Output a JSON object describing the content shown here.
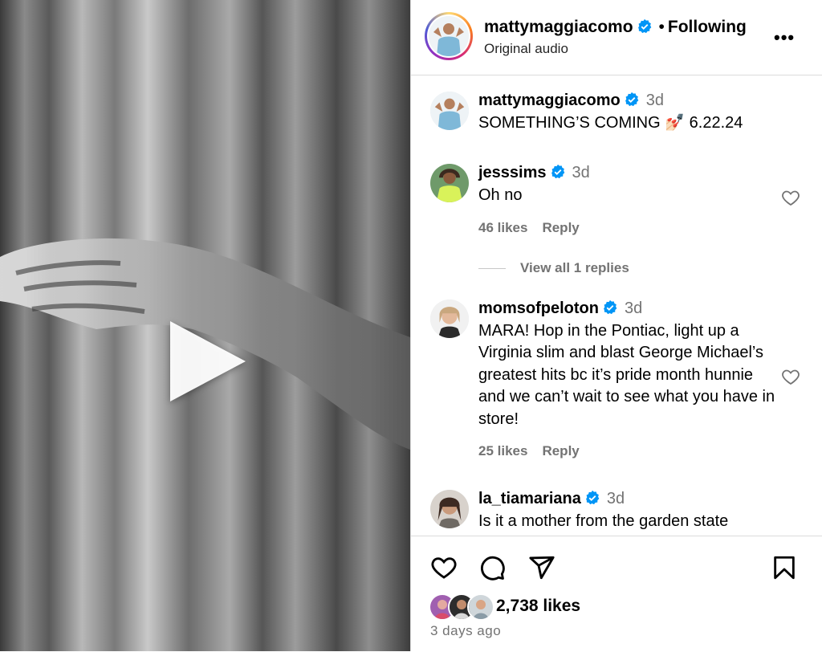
{
  "post": {
    "author": "mattymaggiacomo",
    "follow_status": "Following",
    "audio": "Original audio",
    "more_icon": "more-horizontal-icon"
  },
  "caption": {
    "username": "mattymaggiacomo",
    "time": "3d",
    "text": "SOMETHING’S COMING 💅🏻 6.22.24"
  },
  "comments": [
    {
      "username": "jesssims",
      "time": "3d",
      "text": "Oh no",
      "likes": "46 likes",
      "reply": "Reply",
      "view_replies": "View all 1 replies"
    },
    {
      "username": "momsofpeloton",
      "time": "3d",
      "text": "MARA! Hop in the Pontiac, light up a Virginia slim and blast George Michael’s greatest hits bc it’s pride month hunnie and we can’t wait to see what you have in store!",
      "likes": "25 likes",
      "reply": "Reply"
    },
    {
      "username": "la_tiamariana",
      "time": "3d",
      "text": "Is it a mother from the garden state"
    }
  ],
  "footer": {
    "likes": "2,738 likes",
    "posted": "3 days ago"
  },
  "colors": {
    "verified": "#0095f6",
    "muted": "#737373",
    "border": "#dbdbdb"
  },
  "icons": [
    "play-icon",
    "verified-icon",
    "heart-icon",
    "comment-icon",
    "share-icon",
    "bookmark-icon"
  ]
}
